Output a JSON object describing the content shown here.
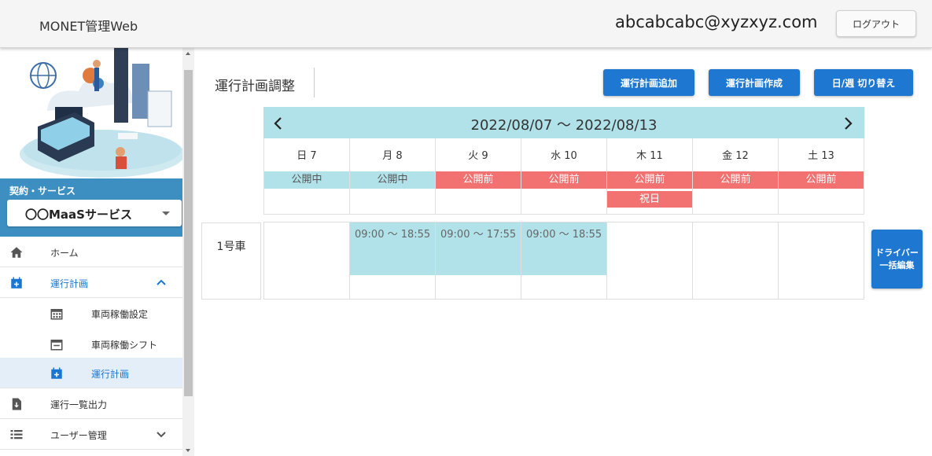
{
  "header": {
    "app_title": "MONET管理Web",
    "user_email": "abcabcabc@xyzxyz.com",
    "logout_label": "ログアウト"
  },
  "sidebar": {
    "contract_label": "契約・サービス",
    "service_selected": "〇〇MaaSサービス",
    "items": [
      {
        "label": "ホーム",
        "icon": "home-icon"
      },
      {
        "label": "運行計画",
        "icon": "calendar-plus-icon",
        "expanded": true
      },
      {
        "label": "車両稼働設定",
        "icon": "calendar-grid-icon"
      },
      {
        "label": "車両稼働シフト",
        "icon": "calendar-minus-icon"
      },
      {
        "label": "運行計画",
        "icon": "calendar-plus-icon",
        "active": true
      },
      {
        "label": "運行一覧出力",
        "icon": "file-download-icon"
      },
      {
        "label": "ユーザー管理",
        "icon": "list-icon"
      }
    ]
  },
  "main": {
    "page_title": "運行計画調整",
    "buttons": {
      "add_plan": "運行計画追加",
      "create_plan": "運行計画作成",
      "toggle_view": "日/週 切り替え"
    },
    "calendar": {
      "range": "2022/08/07 〜 2022/08/13",
      "days": [
        {
          "label": "日 7",
          "status": "公開中",
          "status_type": "public"
        },
        {
          "label": "月 8",
          "status": "公開中",
          "status_type": "public"
        },
        {
          "label": "火 9",
          "status": "公開前",
          "status_type": "pre"
        },
        {
          "label": "水 10",
          "status": "公開前",
          "status_type": "pre"
        },
        {
          "label": "木 11",
          "status": "公開前",
          "status_type": "pre",
          "holiday": "祝日"
        },
        {
          "label": "金 12",
          "status": "公開前",
          "status_type": "pre"
        },
        {
          "label": "土 13",
          "status": "公開前",
          "status_type": "pre"
        }
      ],
      "vehicles": [
        {
          "name": "1号車",
          "slots": [
            "",
            "09:00 〜 18:55",
            "09:00 〜 17:55",
            "09:00 〜 18:55",
            "",
            "",
            ""
          ]
        }
      ]
    },
    "driver_bulk_edit": "ドライバー一括編集"
  },
  "colors": {
    "header_bg": "#f5f5f5",
    "accent_blue": "#1e78d2",
    "public_cyan": "#b1e2ea",
    "pre_red": "#f27171",
    "sidebar_blue": "#3e8fc1"
  }
}
